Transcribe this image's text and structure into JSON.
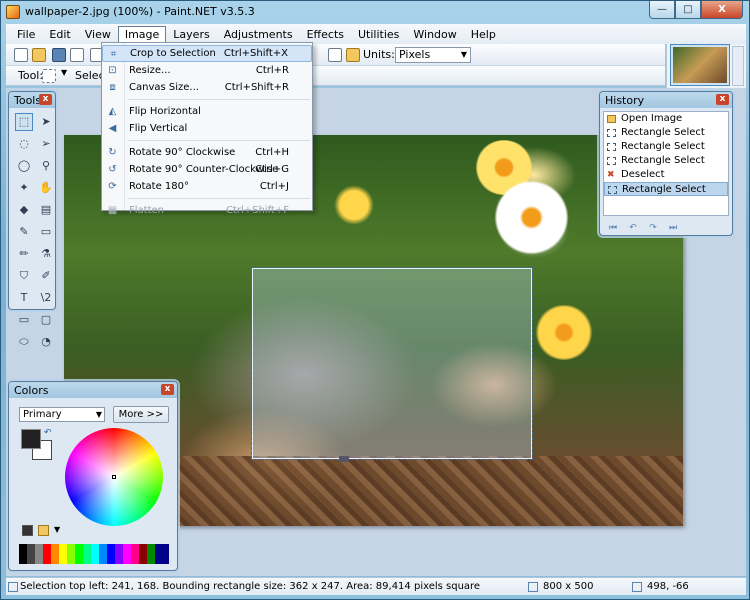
{
  "window": {
    "title": "wallpaper-2.jpg (100%) - Paint.NET v3.5.3",
    "min": "—",
    "max": "□",
    "close": "X"
  },
  "menubar": {
    "items": [
      "File",
      "Edit",
      "View",
      "Image",
      "Layers",
      "Adjustments",
      "Effects",
      "Utilities",
      "Window",
      "Help"
    ],
    "active": "Image"
  },
  "toolbar": {
    "tool_label": "Tool:",
    "selection_label": "Selecti",
    "units_label": "Units:",
    "units_value": "Pixels"
  },
  "image_menu": {
    "items": [
      {
        "label": "Crop to Selection",
        "shortcut": "Ctrl+Shift+X",
        "icon": "crop-icon",
        "highlighted": true
      },
      {
        "label": "Resize...",
        "shortcut": "Ctrl+R",
        "icon": "resize-icon"
      },
      {
        "label": "Canvas Size...",
        "shortcut": "Ctrl+Shift+R",
        "icon": "canvas-size-icon"
      },
      {
        "label": "Flip Horizontal",
        "shortcut": "",
        "icon": "flip-horizontal-icon"
      },
      {
        "label": "Flip Vertical",
        "shortcut": "",
        "icon": "flip-vertical-icon"
      },
      {
        "label": "Rotate 90° Clockwise",
        "shortcut": "Ctrl+H",
        "icon": "rotate-cw-icon"
      },
      {
        "label": "Rotate 90° Counter-Clockwise",
        "shortcut": "Ctrl+G",
        "icon": "rotate-ccw-icon"
      },
      {
        "label": "Rotate 180°",
        "shortcut": "Ctrl+J",
        "icon": "rotate-180-icon"
      },
      {
        "label": "Flatten",
        "shortcut": "Ctrl+Shift+F",
        "icon": "flatten-icon",
        "disabled": true
      }
    ]
  },
  "tools": {
    "title": "Tools"
  },
  "history": {
    "title": "History",
    "items": [
      "Open Image",
      "Rectangle Select",
      "Rectangle Select",
      "Rectangle Select",
      "Deselect",
      "Rectangle Select"
    ],
    "selected_index": 5
  },
  "colors": {
    "title": "Colors",
    "mode": "Primary",
    "more_button": "More >>",
    "primary_color": "#222222",
    "secondary_color": "#ffffff"
  },
  "status": {
    "text": "Selection top left: 241, 168. Bounding rectangle size: 362 x 247. Area: 89,414 pixels square",
    "image_size": "800 x 500",
    "cursor": "498, -66"
  }
}
